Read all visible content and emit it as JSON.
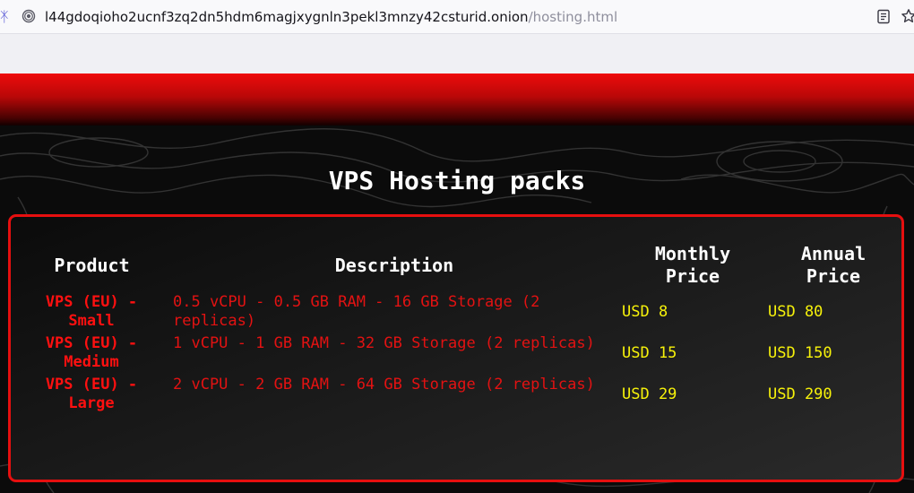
{
  "browser": {
    "url_host": "l44gdoqioho2ucnf3zq2dn5hdm6magjxygnln3pekl3mnzy42csturid.onion",
    "url_path": "/hosting.html",
    "icons": [
      "onion-icon",
      "reader-view-icon",
      "bookmark-star-icon"
    ]
  },
  "page": {
    "title": "VPS Hosting packs",
    "colors": {
      "accent": "#e60f0f",
      "price": "#f7f20a",
      "text": "#ffffff"
    }
  },
  "table": {
    "headers": {
      "product": "Product",
      "description": "Description",
      "monthly_line1": "Monthly",
      "monthly_line2": "Price",
      "annual_line1": "Annual",
      "annual_line2": "Price"
    },
    "rows": [
      {
        "product": "VPS (EU) - Small",
        "description": "0.5 vCPU - 0.5 GB RAM - 16 GB Storage (2 replicas)",
        "monthly": "USD 8",
        "annual": "USD 80"
      },
      {
        "product": "VPS (EU) - Medium",
        "description": "1 vCPU - 1 GB RAM - 32 GB Storage (2 replicas)",
        "monthly": "USD 15",
        "annual": "USD 150"
      },
      {
        "product": "VPS (EU) - Large",
        "description": "2 vCPU - 2 GB RAM - 64 GB Storage (2 replicas)",
        "monthly": "USD 29",
        "annual": "USD 290"
      }
    ]
  }
}
